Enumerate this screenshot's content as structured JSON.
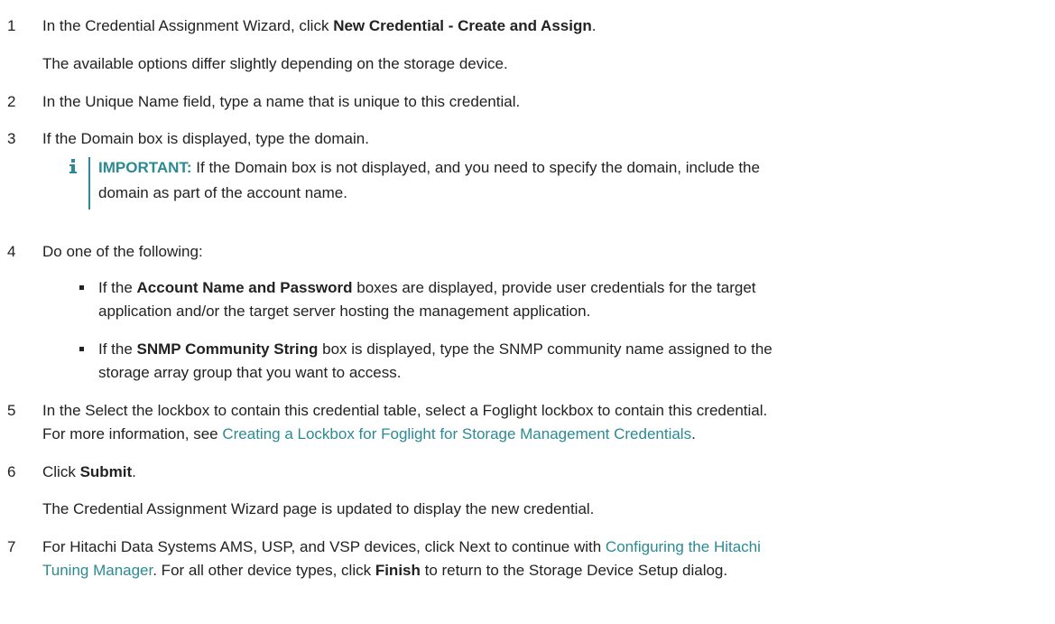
{
  "steps": [
    {
      "num": "1",
      "pre": "In the Credential Assignment Wizard, click ",
      "bold": "New Credential - Create and Assign",
      "post": "."
    },
    {
      "num": "2",
      "text": "In the Unique Name field, type a name that is unique to this credential."
    },
    {
      "num": "3",
      "text": "If the Domain box is displayed, type the domain."
    },
    {
      "num": "4",
      "text": "Do one of the following:"
    },
    {
      "num": "5",
      "line1": "In the Select the lockbox to contain this credential table, select a Foglight lockbox to contain this credential.",
      "line2_pre": "For more information, see ",
      "line2_link": "Creating a Lockbox for Foglight for Storage Management Credentials",
      "line2_post": "."
    },
    {
      "num": "6",
      "pre": "Click ",
      "bold": "Submit",
      "post": "."
    },
    {
      "num": "7",
      "line1_pre": "For Hitachi Data Systems AMS, USP, and VSP devices, click Next to continue with ",
      "line1_link": "Configuring the Hitachi",
      "line2_link": "Tuning Manager",
      "line2_mid": ". For all other device types, click ",
      "line2_bold": "Finish",
      "line2_post": " to return to the Storage Device Setup dialog."
    }
  ],
  "step1_sub": "The available options differ slightly depending on the storage device.",
  "step6_sub": "The Credential Assignment Wizard page is updated to display the new credential.",
  "note": {
    "label": "IMPORTANT:",
    "line1": " If the Domain box is not displayed, and you need to specify the domain, include the",
    "line2": "domain as part of the account name."
  },
  "bullets": [
    {
      "pre": "If the ",
      "bold": "Account Name and Password",
      "line1_post": " boxes are displayed, provide user credentials for the target",
      "line2": "application and/or the target server hosting the management application."
    },
    {
      "pre": "If the ",
      "bold": "SNMP Community String",
      "line1_post": " box is displayed, type the SNMP community name assigned to the",
      "line2": "storage array group that you want to access."
    }
  ],
  "colors": {
    "link": "#2b8a93",
    "text": "#222222"
  }
}
